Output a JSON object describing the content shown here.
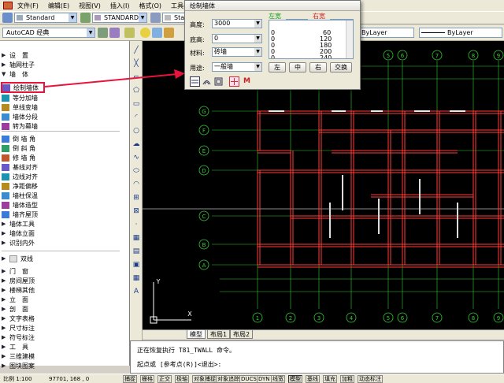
{
  "menubar": {
    "items": [
      "文件(F)",
      "编辑(E)",
      "视图(V)",
      "插入(I)",
      "格式(O)",
      "工具(T)"
    ]
  },
  "toolbar1": {
    "text_style": "Standard",
    "dim_style": "STANDARD",
    "table_style": "Standard"
  },
  "toolbar2": {
    "workspace": "AutoCAD 经典",
    "bylayer_1": "ByLayer",
    "bylayer_2": "ByLayer"
  },
  "left_panel": {
    "items": [
      {
        "label": "设　置",
        "kind": "folder"
      },
      {
        "label": "轴网柱子",
        "kind": "folder"
      },
      {
        "label": "墙　体",
        "kind": "folder-open"
      },
      {
        "label": "绘制墙体",
        "kind": "cmd",
        "selected": true
      },
      {
        "label": "等分加墙",
        "kind": "cmd"
      },
      {
        "label": "单线变墙",
        "kind": "cmd"
      },
      {
        "label": "墙体分段",
        "kind": "cmd"
      },
      {
        "label": "转为幕墙",
        "kind": "cmd"
      },
      {
        "label": "倒 墙 角",
        "kind": "cmd"
      },
      {
        "label": "倒 斜 角",
        "kind": "cmd"
      },
      {
        "label": "修 墙 角",
        "kind": "cmd"
      },
      {
        "label": "基线对齐",
        "kind": "cmd"
      },
      {
        "label": "边线对齐",
        "kind": "cmd"
      },
      {
        "label": "净距偏移",
        "kind": "cmd"
      },
      {
        "label": "墙柱保温",
        "kind": "cmd"
      },
      {
        "label": "墙体造型",
        "kind": "cmd"
      },
      {
        "label": "墙齐屋顶",
        "kind": "cmd"
      },
      {
        "label": "墙体工具",
        "kind": "folder"
      },
      {
        "label": "墙体立面",
        "kind": "folder"
      },
      {
        "label": "识别内外",
        "kind": "folder"
      },
      {
        "label": "双线",
        "kind": "folder-alt"
      },
      {
        "label": "门　窗",
        "kind": "folder"
      },
      {
        "label": "房间屋顶",
        "kind": "folder"
      },
      {
        "label": "楼梯其他",
        "kind": "folder"
      },
      {
        "label": "立　面",
        "kind": "folder"
      },
      {
        "label": "剖　面",
        "kind": "folder"
      },
      {
        "label": "文字表格",
        "kind": "folder"
      },
      {
        "label": "尺寸标注",
        "kind": "folder"
      },
      {
        "label": "符号标注",
        "kind": "folder"
      },
      {
        "label": "工　具",
        "kind": "folder"
      },
      {
        "label": "三维建模",
        "kind": "folder"
      },
      {
        "label": "图块图案",
        "kind": "folder"
      }
    ]
  },
  "dialog": {
    "title": "绘制墙体",
    "height_label": "高度:",
    "height_value": "3000",
    "base_label": "底高:",
    "base_value": "0",
    "material_label": "材料:",
    "material_value": "砖墙",
    "usage_label": "用途:",
    "usage_value": "一般墙",
    "left_width_label": "左宽",
    "left_width_value": "120",
    "right_width_label": "右宽",
    "right_width_value": "120",
    "list_left": [
      "0",
      "0",
      "0",
      "0",
      "0"
    ],
    "list_right": [
      "60",
      "120",
      "180",
      "200",
      "240"
    ],
    "btn_left": "左",
    "btn_center": "中",
    "btn_right": "右",
    "btn_swap": "交换",
    "m_label": "M"
  },
  "drawing": {
    "top_axis_labels": [
      "1",
      "2",
      "3",
      "4",
      "5",
      "6",
      "7",
      "8",
      "9"
    ],
    "bottom_axis_labels": [
      "1",
      "2",
      "3",
      "4",
      "5",
      "6",
      "7",
      "8",
      "9"
    ],
    "row_axis_labels": [
      "G",
      "F",
      "E",
      "D",
      "C",
      "B",
      "A"
    ],
    "ucs_y": "Y",
    "ucs_x": "X"
  },
  "tabs": {
    "model": "模型",
    "layout1": "布局1",
    "layout2": "布局2"
  },
  "command": {
    "line1": "正在恢复执行 T81_TWALL 命令。",
    "line2": "起点或 [参考点(R)]<退出>:"
  },
  "statusbar": {
    "scale": "比例 1:100",
    "coords": "97701, 168 , 0",
    "buttons": [
      "捕捉",
      "栅格",
      "正交",
      "极轴",
      "对象捕捉",
      "对象追踪",
      "DUCS",
      "DYN",
      "线宽",
      "模型",
      "基线",
      "填充",
      "加粗",
      "动态标注"
    ]
  },
  "colors": {
    "selection": "#e8143c",
    "wall": "#ff3c3c",
    "axis": "#33cc33",
    "grey_line": "#b8b8b8"
  }
}
